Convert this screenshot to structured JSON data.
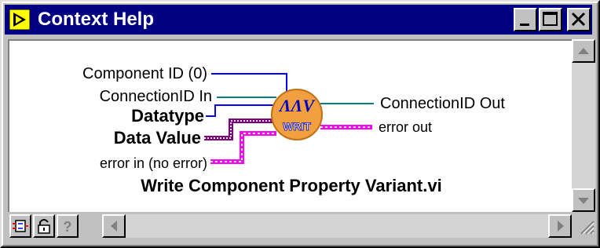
{
  "window": {
    "title": "Context Help"
  },
  "caption_buttons": {
    "minimize": "minimize-icon",
    "maximize": "maximize-icon",
    "close": "close-icon"
  },
  "diagram": {
    "inputs": [
      {
        "label": "Component ID (0)",
        "bold": false
      },
      {
        "label": "ConnectionID In",
        "bold": false
      },
      {
        "label": "Datatype",
        "bold": true
      },
      {
        "label": "Data Value",
        "bold": true
      },
      {
        "label": "error in (no error)",
        "bold": false
      }
    ],
    "outputs": [
      {
        "label": "ConnectionID Out"
      },
      {
        "label": "error out"
      }
    ],
    "node_icon_text": "WRIT",
    "vi_name": "Write Component Property Variant.vi"
  },
  "colors": {
    "titlebar": "#000080",
    "cluster_wire": "#ff00ff",
    "refnum_wire": "#008080",
    "scalar_wire": "#0000ff",
    "variant_wire": "#800080",
    "node_fill": "#f0a040"
  },
  "toolbar": {
    "buttons": [
      "show-optional-terminals-icon",
      "lock-icon",
      "help-question-icon"
    ]
  }
}
